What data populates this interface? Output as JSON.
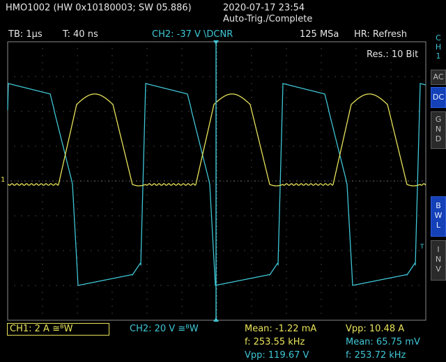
{
  "header": {
    "model": "HMO1002 (HW 0x10180003; SW 05.886)",
    "datetime": "2020-07-17 23:54",
    "trigger_status": "Auto-Trig./Complete"
  },
  "status_bar": {
    "timebase": "TB: 1µs",
    "trigger_time": "T: 40 ns",
    "trigger_source": "CH2: -37 V \\DCNR",
    "sample_rate": "125 MSa",
    "hr_mode": "HR: Refresh"
  },
  "resolution": "Res.: 10 Bit",
  "sidebar": {
    "channel_label": [
      "C",
      "H",
      "1"
    ],
    "buttons": [
      {
        "id": "ac",
        "label": [
          "AC"
        ],
        "active": false
      },
      {
        "id": "dc",
        "label": [
          "DC"
        ],
        "active": true
      },
      {
        "id": "gnd",
        "label": [
          "G",
          "N",
          "D"
        ],
        "active": false
      },
      {
        "id": "bwl",
        "label": [
          "B",
          "W",
          "L"
        ],
        "active": true
      },
      {
        "id": "inv",
        "label": [
          "I",
          "N",
          "V"
        ],
        "active": false
      }
    ]
  },
  "footer": {
    "ch1_setting": "CH1: 2 A ≅ᴮW",
    "ch2_setting": "CH2: 20 V ≅ᴮW",
    "ch1_measurements": [
      "Mean: -1.22 mA",
      "f: 253.55 kHz",
      "Vpp: 119.67 V"
    ],
    "ch2_measurements": [
      "Vpp: 10.48 A",
      "Mean: 65.75 mV",
      "f: 253.72 kHz"
    ]
  },
  "markers": {
    "ch1_ground": "1",
    "trigger_level": "T"
  },
  "colors": {
    "ch1": "#e8e35a",
    "ch2": "#3fc7d6",
    "grid": "#7a7a7a",
    "active_button": "#1440b8"
  }
}
